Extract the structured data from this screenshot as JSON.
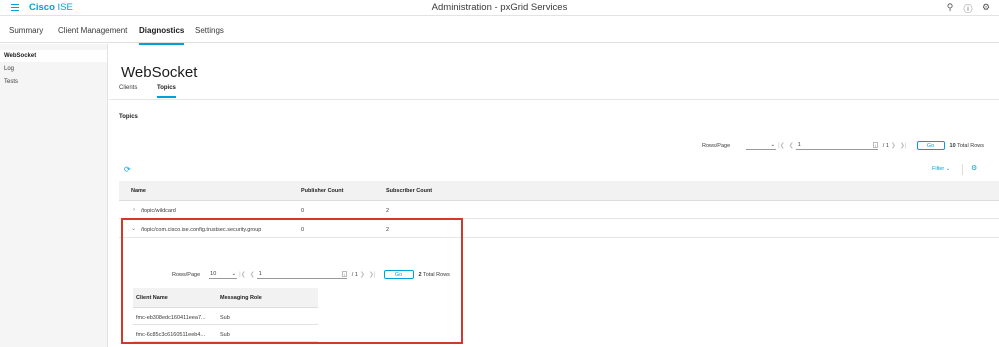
{
  "header": {
    "brand": "Cisco",
    "product": "ISE",
    "title": "Administration - pxGrid Services",
    "icons": [
      "search-icon",
      "help-icon",
      "settings-icon"
    ]
  },
  "navtabs": [
    "Summary",
    "Client Management",
    "Diagnostics",
    "Settings"
  ],
  "sidebar": {
    "items": [
      "WebSocket",
      "Log",
      "Tests"
    ]
  },
  "page": {
    "title": "WebSocket",
    "subtabs": [
      "Clients",
      "Topics"
    ],
    "section_title": "Topics"
  },
  "pager": {
    "rows_label": "Rows/Page",
    "rows_value": "",
    "page": "1",
    "of_pages": "/ 1",
    "go": "Go",
    "total": "10",
    "total_label": "Total Rows"
  },
  "toolbar": {
    "filter_label": "Filter"
  },
  "table": {
    "columns": [
      "Name",
      "Publisher Count",
      "Subscriber Count"
    ],
    "rows": [
      {
        "name": "/topic/wildcard",
        "publisher": "0",
        "subscriber": "2"
      },
      {
        "name": "/topic/com.cisco.ise.config.trustsec.security.group",
        "publisher": "0",
        "subscriber": "2"
      }
    ]
  },
  "sub_pager": {
    "rows_label": "Rows/Page",
    "rows_value": "10",
    "page": "1",
    "of_pages": "/ 1",
    "go": "Go",
    "total": "2",
    "total_label": "Total Rows"
  },
  "sub_table": {
    "columns": [
      "Client Name",
      "Messaging Role"
    ],
    "rows": [
      {
        "client": "fmc-eb308edc160411eea7...",
        "role": "Sub"
      },
      {
        "client": "fmc-6c85c3c6160511eeb4...",
        "role": "Sub"
      }
    ]
  },
  "colors": {
    "accent": "#049fd9",
    "highlight": "#d13a2a"
  }
}
